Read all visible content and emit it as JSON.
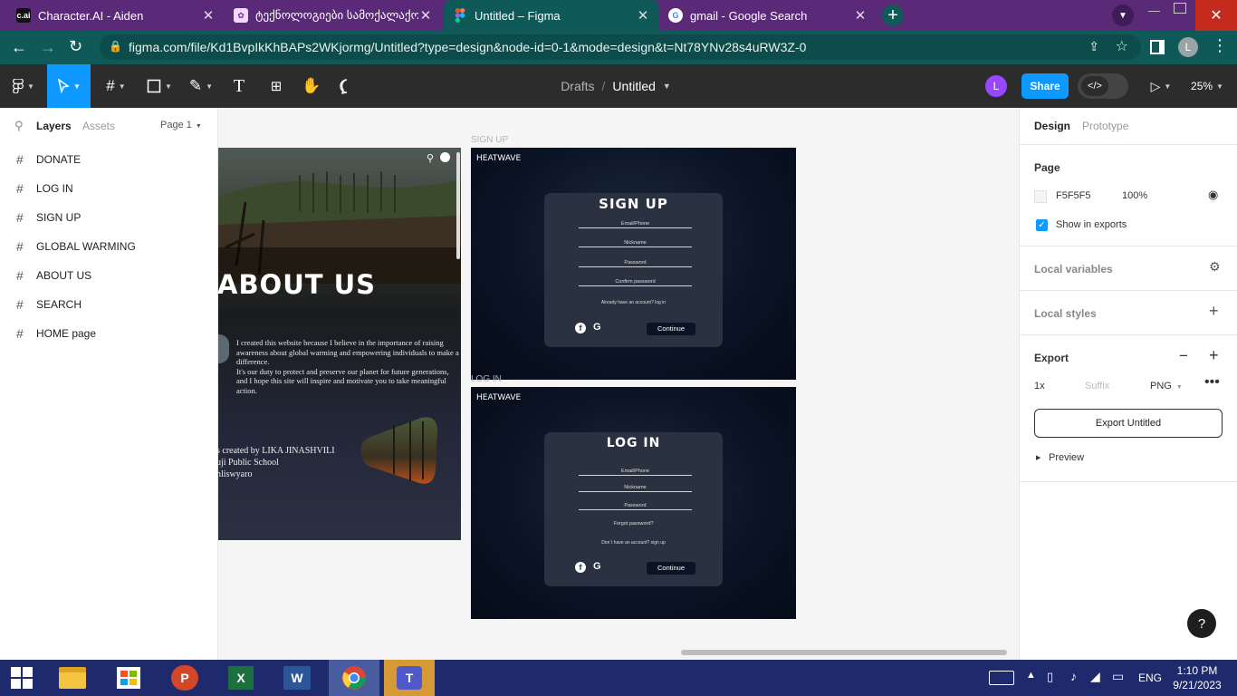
{
  "browser": {
    "tabs": [
      {
        "title": "Character.AI - Aiden",
        "favicon": "c.ai"
      },
      {
        "title": "ტექნოლოგიები სამოქალაქო",
        "favicon": "app-icon"
      },
      {
        "title": "Untitled – Figma",
        "favicon": "figma-icon"
      },
      {
        "title": "gmail - Google Search",
        "favicon": "google-icon"
      }
    ],
    "url": "figma.com/file/Kd1BvpIkKhBAPs2WKjormg/Untitled?type=design&node-id=0-1&mode=design&t=Nt78YNv28s4uRW3Z-0",
    "profile_initial": "L"
  },
  "figma": {
    "breadcrumb_drafts": "Drafts",
    "breadcrumb_sep": "/",
    "file_name": "Untitled",
    "user_initial": "L",
    "share_label": "Share",
    "zoom": "25%"
  },
  "left_panel": {
    "tab_layers": "Layers",
    "tab_assets": "Assets",
    "page_selector": "Page 1",
    "layers": [
      "DONATE",
      "LOG IN",
      "SIGN UP",
      "GLOBAL WARMING",
      "ABOUT US",
      "SEARCH",
      "HOME page"
    ]
  },
  "canvas": {
    "signup_frame_label": "SIGN UP",
    "login_frame_label": "LOG IN",
    "about": {
      "heading": "ABOUT US",
      "para1": "I created this website because I believe in the importance of raising awareness about global warming and empowering individuals to make a difference.",
      "para2": "It's our duty to protect and preserve our planet for future generations, and I hope this site will inspire and motivate you to take meaningful action.",
      "credit1": "s created by LIKA JINASHVILI",
      "credit2": "uji Public School",
      "credit3": "hliswyaro"
    },
    "brand": "HEATWAVE",
    "signup": {
      "title": "SIGN UP",
      "fields": [
        "Email/Phone",
        "Nickname",
        "Password",
        "Confirm password"
      ],
      "note": "Already have an account? log in",
      "continue": "Continue"
    },
    "login": {
      "title": "LOG IN",
      "fields": [
        "Email/Phone",
        "Nickname",
        "Password"
      ],
      "forgot": "Forgot password?",
      "note": "Don`t have an account? sign up",
      "continue": "Continue"
    }
  },
  "right_panel": {
    "tab_design": "Design",
    "tab_prototype": "Prototype",
    "page_title": "Page",
    "page_color": "F5F5F5",
    "page_opacity": "100%",
    "show_in_exports": "Show in exports",
    "local_variables": "Local variables",
    "local_styles": "Local styles",
    "export_title": "Export",
    "export_scale": "1x",
    "export_suffix_placeholder": "Suffix",
    "export_format": "PNG",
    "export_button": "Export Untitled",
    "preview": "Preview",
    "help": "?"
  },
  "taskbar": {
    "lang": "ENG",
    "time": "1:10 PM",
    "date": "9/21/2023"
  },
  "colors": {
    "tabbar": "#5a2a78",
    "browser_toolbar": "#0f5a58",
    "figma_toolbar": "#2c2c2c",
    "accent": "#0d99ff",
    "frame_dark": "#081122",
    "card": "#2a3140",
    "taskbar": "#1e2a6b"
  }
}
